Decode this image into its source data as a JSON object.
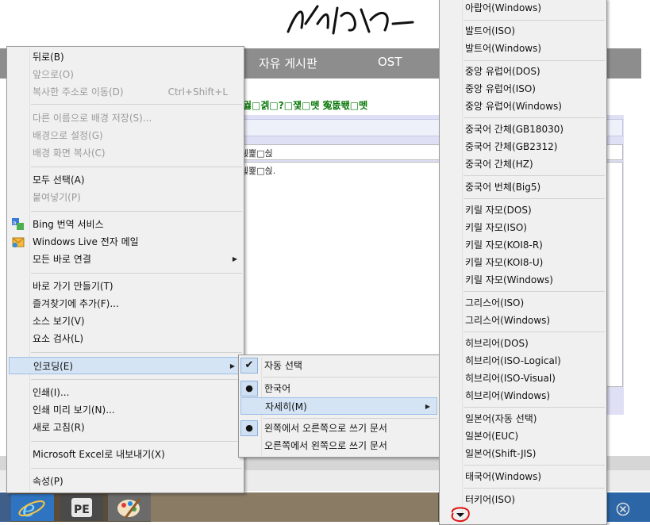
{
  "page": {
    "nav": [
      "자유 게시판",
      "OST"
    ],
    "garbled_line": "궗□겕□?□쟻□뗏 寃뚮뙋□뗏",
    "input_text": "쉕뾽□쉱",
    "textarea_text": "쉕뾽□쉱."
  },
  "context_menu": {
    "items": [
      {
        "label": "뒤로(B)",
        "disabled": false
      },
      {
        "label": "앞으로(O)",
        "disabled": true
      },
      {
        "label": "복사한 주소로 이동(D)",
        "shortcut": "Ctrl+Shift+L",
        "disabled": true
      },
      {
        "label": "다른 이름으로 배경 저장(S)...",
        "disabled": true
      },
      {
        "label": "배경으로 설정(G)",
        "disabled": true
      },
      {
        "label": "배경 화면 복사(C)",
        "disabled": true
      },
      {
        "label": "모두 선택(A)",
        "disabled": false
      },
      {
        "label": "붙여넣기(P)",
        "disabled": true
      },
      {
        "label": "Bing 번역 서비스",
        "icon": "bing-translator-icon"
      },
      {
        "label": "Windows Live 전자 메일",
        "icon": "windows-live-mail-icon"
      },
      {
        "label": "모든 바로 연결",
        "submenu": true
      },
      {
        "label": "바로 가기 만들기(T)"
      },
      {
        "label": "즐겨찾기에 추가(F)..."
      },
      {
        "label": "소스 보기(V)"
      },
      {
        "label": "요소 검사(L)"
      },
      {
        "label": "인코딩(E)",
        "submenu": true,
        "highlighted": true
      },
      {
        "label": "인쇄(I)..."
      },
      {
        "label": "인쇄 미리 보기(N)..."
      },
      {
        "label": "새로 고침(R)"
      },
      {
        "label": "Microsoft Excel로 내보내기(X)"
      },
      {
        "label": "속성(P)"
      }
    ]
  },
  "encoding_menu": {
    "items": [
      {
        "label": "자동 선택",
        "mark": "check"
      },
      {
        "label": "한국어",
        "mark": "dot"
      },
      {
        "label": "자세히(M)",
        "submenu": true,
        "highlighted": true
      },
      {
        "label": "왼쪽에서 오른쪽으로 쓰기 문서",
        "mark": "dot"
      },
      {
        "label": "오른쪽에서 왼쪽으로 쓰기 문서"
      }
    ]
  },
  "more_menu": {
    "items": [
      "아랍어(Windows)",
      "발트어(ISO)",
      "발트어(Windows)",
      "중앙 유럽어(DOS)",
      "중앙 유럽어(ISO)",
      "중앙 유럽어(Windows)",
      "중국어 간체(GB18030)",
      "중국어 간체(GB2312)",
      "중국어 간체(HZ)",
      "중국어 번체(Big5)",
      "키릴 자모(DOS)",
      "키릴 자모(ISO)",
      "키릴 자모(KOI8-R)",
      "키릴 자모(KOI8-U)",
      "키릴 자모(Windows)",
      "그리스어(ISO)",
      "그리스어(Windows)",
      "히브리어(DOS)",
      "히브리어(ISO-Logical)",
      "히브리어(ISO-Visual)",
      "히브리어(Windows)",
      "일본어(자동 선택)",
      "일본어(EUC)",
      "일본어(Shift-JIS)",
      "태국어(Windows)",
      "터키어(ISO)"
    ],
    "scroll_icon": "scroll-down-arrow-icon"
  },
  "taskbar": {
    "apps": [
      "internet-explorer-icon",
      "photoscape-icon",
      "paint-icon"
    ],
    "close_icon": "close-circle-icon"
  }
}
